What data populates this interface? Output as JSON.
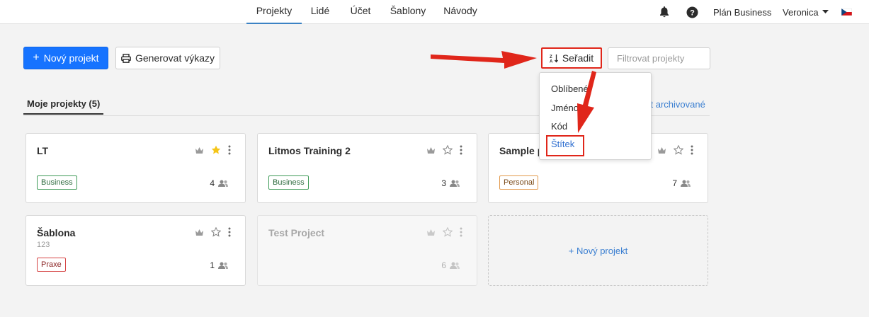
{
  "nav": {
    "tabs": [
      "Projekty",
      "Lidé",
      "Účet",
      "Šablony",
      "Návody"
    ],
    "active_tab": "Projekty",
    "plan": "Plán Business",
    "user": "Veronica"
  },
  "toolbar": {
    "new_project_label": "Nový projekt",
    "reports_label": "Generovat výkazy",
    "sort_label": "Seřadit",
    "filter_placeholder": "Filtrovat projekty"
  },
  "section": {
    "tab_label": "Moje projekty (5)",
    "archived_link": "ýt archivované"
  },
  "sort_menu": {
    "items": [
      "Oblíbené",
      "Jméno",
      "Kód",
      "Štítek"
    ],
    "active": "Štítek"
  },
  "projects": [
    {
      "title": "LT",
      "code": "",
      "tag": "Business",
      "members": "4",
      "favorite": true
    },
    {
      "title": "Litmos Training 2",
      "code": "",
      "tag": "Business",
      "members": "3",
      "favorite": false
    },
    {
      "title": "Sample pr",
      "code": "",
      "tag": "Personal",
      "members": "7",
      "favorite": false
    },
    {
      "title": "Šablona",
      "code": "123",
      "tag": "Praxe",
      "members": "1",
      "favorite": false
    },
    {
      "title": "Test Project",
      "code": "",
      "tag": "",
      "members": "6",
      "favorite": false
    }
  ],
  "new_project_card_label": "+ Nový projekt",
  "colors": {
    "primary": "#1673ff",
    "link": "#3b7fd1",
    "annotation_red": "#e0261a",
    "star_active": "#f5c518"
  }
}
